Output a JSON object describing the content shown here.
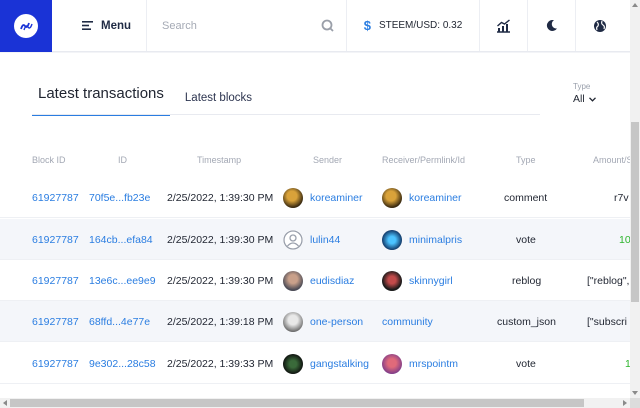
{
  "header": {
    "menu_label": "Menu",
    "search_placeholder": "Search",
    "price_label": "STEEM/USD: 0.32",
    "brand_color": "#1a33d6",
    "accent_color": "#2a7de1"
  },
  "tabs": {
    "active": "Latest transactions",
    "other": "Latest blocks"
  },
  "type_filter": {
    "label": "Type",
    "value": "All"
  },
  "table": {
    "columns": [
      "Block ID",
      "ID",
      "Timestamp",
      "Sender",
      "Receiver/Permlink/Id",
      "Type",
      "Amount/S"
    ],
    "rows": [
      {
        "block": "61927787",
        "id": "70f5e...fb23e",
        "time": "2/25/2022, 1:39:30 PM",
        "sender": "koreaminer",
        "receiver": "koreaminer",
        "type": "comment",
        "amount": "r7v"
      },
      {
        "block": "61927787",
        "id": "164cb...efa84",
        "time": "2/25/2022, 1:39:30 PM",
        "sender": "lulin44",
        "receiver": "minimalpris",
        "type": "vote",
        "amount": "10"
      },
      {
        "block": "61927787",
        "id": "13e6c...ee9e9",
        "time": "2/25/2022, 1:39:30 PM",
        "sender": "eudisdiaz",
        "receiver": "skinnygirl",
        "type": "reblog",
        "amount": "[\"reblog\","
      },
      {
        "block": "61927787",
        "id": "68ffd...4e77e",
        "time": "2/25/2022, 1:39:18 PM",
        "sender": "one-person",
        "receiver": "community",
        "type": "custom_json",
        "amount": "[\"subscri"
      },
      {
        "block": "61927787",
        "id": "9e302...28c58",
        "time": "2/25/2022, 1:39:33 PM",
        "sender": "gangstalking",
        "receiver": "mrspointm",
        "type": "vote",
        "amount": "1"
      }
    ]
  }
}
